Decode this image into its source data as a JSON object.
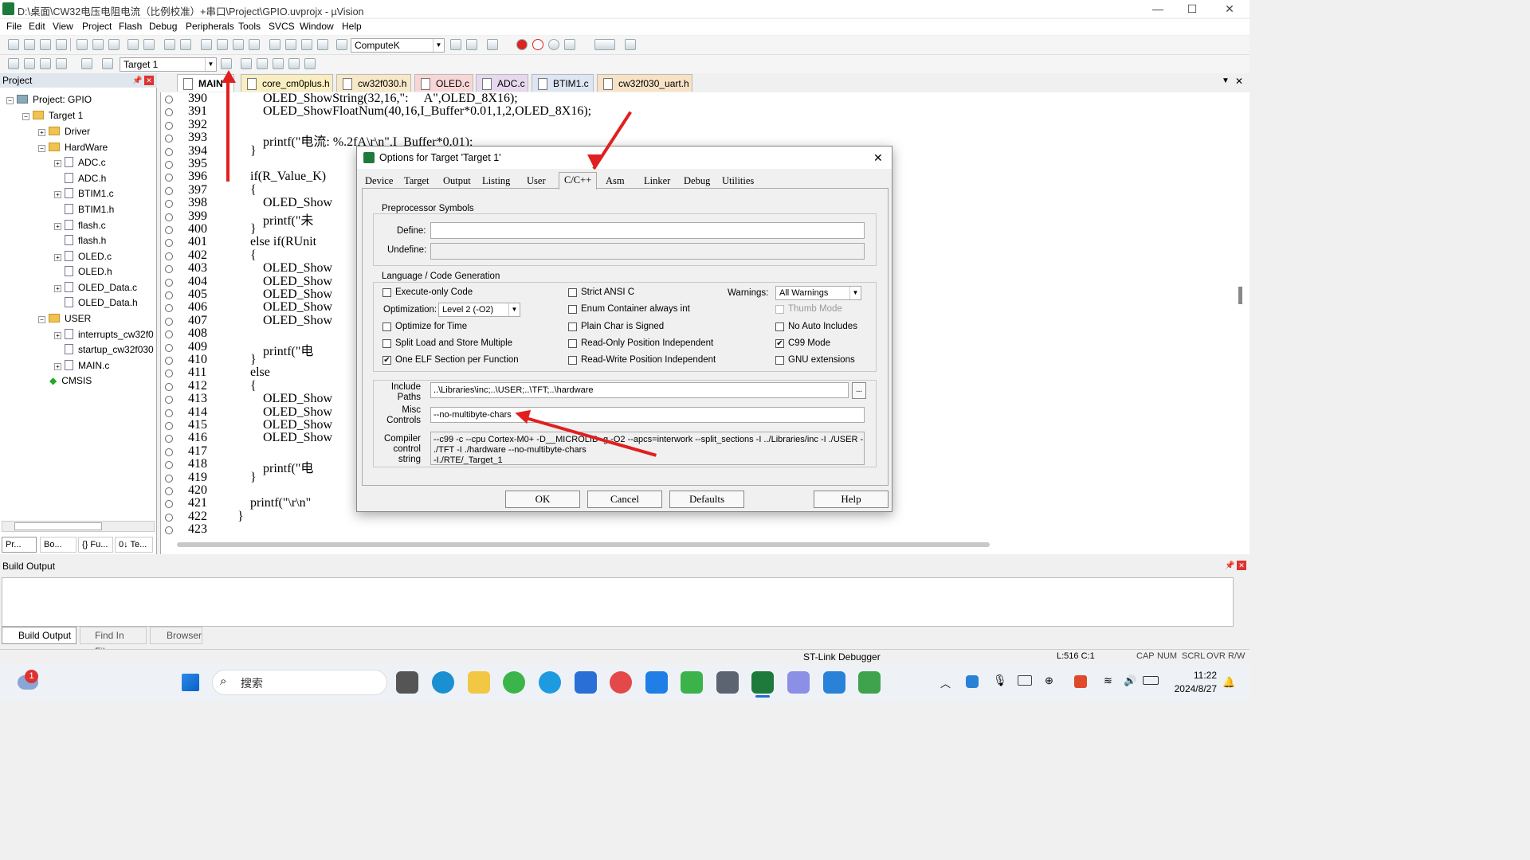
{
  "window": {
    "title": "D:\\桌面\\CW32电压电阻电流（比例校准）+串口\\Project\\GPIO.uvprojx - µVision",
    "minimize": "—",
    "maximize": "☐",
    "close": "✕"
  },
  "menubar": [
    "File",
    "Edit",
    "View",
    "Project",
    "Flash",
    "Debug",
    "Peripherals",
    "Tools",
    "SVCS",
    "Window",
    "Help"
  ],
  "toolbar": {
    "find_combo": "ComputeK",
    "target_combo": "Target 1"
  },
  "project": {
    "header": "Project",
    "root": "Project: GPIO",
    "target": "Target 1",
    "groups": [
      {
        "name": "Driver"
      },
      {
        "name": "HardWare",
        "files": [
          "ADC.c",
          "ADC.h",
          "BTIM1.c",
          "BTIM1.h",
          "flash.c",
          "flash.h",
          "OLED.c",
          "OLED.h",
          "OLED_Data.c",
          "OLED_Data.h"
        ]
      },
      {
        "name": "USER",
        "files": [
          "interrupts_cw32f0",
          "startup_cw32f030",
          "MAIN.c"
        ]
      }
    ],
    "cmsis": "CMSIS",
    "bottom_tabs": [
      "Pr...",
      "Bo...",
      "{} Fu...",
      "0↓ Te..."
    ]
  },
  "editor_tabs": [
    "MAIN",
    "core_cm0plus.h",
    "cw32f030.h",
    "OLED.c",
    "ADC.c",
    "BTIM1.c",
    "cw32f030_uart.h"
  ],
  "editor": {
    "lines": [
      "390",
      "391",
      "392",
      "393",
      "394",
      "395",
      "396",
      "397",
      "398",
      "399",
      "400",
      "401",
      "402",
      "403",
      "404",
      "405",
      "406",
      "407",
      "408",
      "409",
      "410",
      "411",
      "412",
      "413",
      "414",
      "415",
      "416",
      "417",
      "418",
      "419",
      "420",
      "421",
      "422",
      "423"
    ],
    "code": [
      "            OLED_ShowString(32,16,\":     A\",OLED_8X16);",
      "            OLED_ShowFloatNum(40,16,I_Buffer*0.01,1,2,OLED_8X16);",
      "",
      "            printf(\"电流: %.2fA\\r\\n\",I_Buffer*0.01);",
      "        }",
      "",
      "        if(R_Value_K)",
      "        {",
      "            OLED_Show",
      "            printf(\"未",
      "        }",
      "        else if(RUnit",
      "        {",
      "            OLED_Show",
      "            OLED_Show",
      "            OLED_Show",
      "            OLED_Show",
      "            OLED_Show",
      "",
      "            printf(\"电",
      "        }",
      "        else",
      "        {",
      "            OLED_Show",
      "            OLED_Show",
      "            OLED_Show",
      "            OLED_Show",
      "",
      "            printf(\"电",
      "        }",
      "",
      "        printf(\"\\r\\n\"",
      "    }",
      ""
    ]
  },
  "dialog": {
    "title": "Options for Target 'Target 1'",
    "close": "✕",
    "tabs": [
      "Device",
      "Target",
      "Output",
      "Listing",
      "User",
      "C/C++",
      "Asm",
      "Linker",
      "Debug",
      "Utilities"
    ],
    "preprocessor": {
      "label": "Preprocessor Symbols",
      "define_label": "Define:",
      "define_value": "",
      "undefine_label": "Undefine:",
      "undefine_value": ""
    },
    "language": {
      "label": "Language / Code Generation",
      "execute_only": "Execute-only Code",
      "optimization_label": "Optimization:",
      "optimization_value": "Level 2 (-O2)",
      "optimize_time": "Optimize for Time",
      "split_load": "Split Load and Store Multiple",
      "one_elf": "One ELF Section per Function",
      "strict_ansi": "Strict ANSI C",
      "enum_container": "Enum Container always int",
      "plain_char": "Plain Char is Signed",
      "ro_pi": "Read-Only Position Independent",
      "rw_pi": "Read-Write Position Independent",
      "warnings_label": "Warnings:",
      "warnings_value": "All Warnings",
      "thumb_mode": "Thumb Mode",
      "no_auto_includes": "No Auto Includes",
      "c99_mode": "C99 Mode",
      "gnu_ext": "GNU extensions"
    },
    "include_label": "Include Paths",
    "include_value": "..\\Libraries\\inc;..\\USER;..\\TFT;..\\hardware",
    "browse": "...",
    "misc_label": "Misc Controls",
    "misc_value": "--no-multibyte-chars",
    "compiler_label": "Compiler control string",
    "compiler_lines": [
      "--c99 -c --cpu Cortex-M0+ -D__MICROLIB -g -O2 --apcs=interwork --split_sections -I ../Libraries/inc -I ./USER -I",
      "./TFT -I ./hardware --no-multibyte-chars",
      "-I./RTE/_Target_1"
    ],
    "buttons": {
      "ok": "OK",
      "cancel": "Cancel",
      "defaults": "Defaults",
      "help": "Help"
    }
  },
  "build": {
    "header": "Build Output",
    "tabs": [
      "Build Output",
      "Find In Files",
      "Browser"
    ]
  },
  "status": {
    "debugger": "ST-Link Debugger",
    "position": "L:516 C:1",
    "indicators": [
      "CAP",
      "NUM",
      "SCRL",
      "OVR",
      "R/W"
    ]
  },
  "taskbar": {
    "search": "搜索",
    "time": "11:22",
    "date": "2024/8/27",
    "badge": "1"
  },
  "colors": {
    "arrow": "#e02020",
    "accent": "#1e7a3a"
  }
}
